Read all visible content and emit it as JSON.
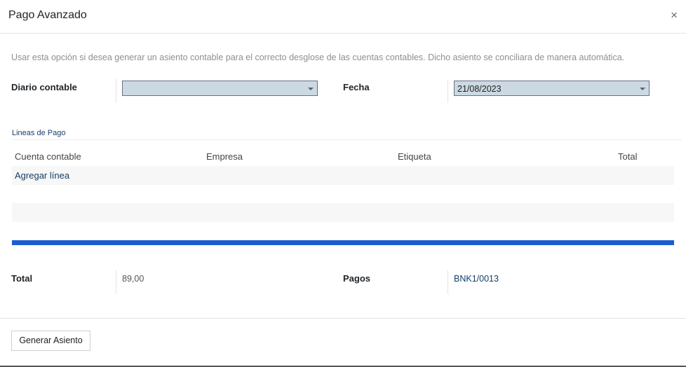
{
  "dialog": {
    "title": "Pago Avanzado",
    "close_label": "×"
  },
  "helper_text": "Usar esta opción si desea generar un asiento contable para el correcto desglose de las cuentas contables. Dicho asiento se conciliara de manera automática.",
  "form": {
    "journal_label": "Diario contable",
    "journal_value": "",
    "date_label": "Fecha",
    "date_value": "21/08/2023"
  },
  "payment_lines": {
    "title": "Lineas de Pago",
    "columns": [
      "Cuenta contable",
      "Empresa",
      "Etiqueta",
      "Total"
    ],
    "add_line_label": "Agregar línea"
  },
  "summary": {
    "total_label": "Total",
    "total_value": "89,00",
    "payments_label": "Pagos",
    "payments_value": "BNK1/0013"
  },
  "footer": {
    "generate_button": "Generar Asiento"
  },
  "colors": {
    "accent_bar": "#1a5dd1",
    "select_bg": "#ccd9e3",
    "link": "#123f66"
  }
}
